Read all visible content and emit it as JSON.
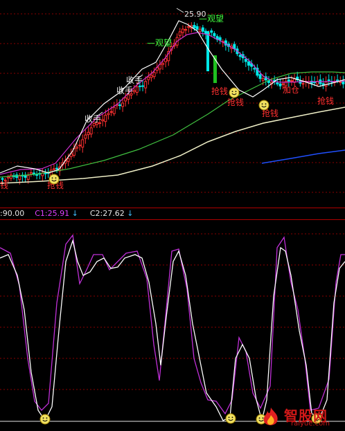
{
  "info_bar": {
    "c0": ":90.00",
    "c1_label": "C1:25.91",
    "c2_label": "C2:27.62",
    "arrow": "↓"
  },
  "watermark": {
    "text": "智股网",
    "url": "raiyue.com"
  },
  "colors": {
    "bg": "#000000",
    "up": "#ff3030",
    "down": "#00e8e8",
    "line_white": "#ffffff",
    "line_magenta": "#d030d0",
    "line_green": "#40c040",
    "line_cream": "#f0f0c8",
    "line_blue": "#2050ff",
    "label_red": "#ff3030",
    "label_green": "#40ff40",
    "grid": "#8b0000",
    "separator": "#b00000"
  },
  "chart_data": [
    {
      "type": "candlestick",
      "peak_label": "25.90",
      "signals": [
        {
          "text": "收手",
          "color": "white"
        },
        {
          "text": "收手",
          "color": "white"
        },
        {
          "text": "收手",
          "color": "white"
        },
        {
          "text": "观望",
          "color": "green"
        },
        {
          "text": "观望",
          "color": "green"
        },
        {
          "text": "抢钱",
          "color": "red"
        },
        {
          "text": "抢钱",
          "color": "red"
        },
        {
          "text": "抢钱",
          "color": "red"
        },
        {
          "text": "抢钱",
          "color": "red"
        },
        {
          "text": "加仓",
          "color": "red"
        },
        {
          "text": "抢钱",
          "color": "red"
        },
        {
          "text": "钱",
          "color": "red"
        }
      ],
      "smiley_count": 3,
      "ylim": [
        12,
        27
      ]
    },
    {
      "type": "line",
      "series_count": 2,
      "ylim": [
        0,
        100
      ],
      "smiley_count": 4
    }
  ]
}
